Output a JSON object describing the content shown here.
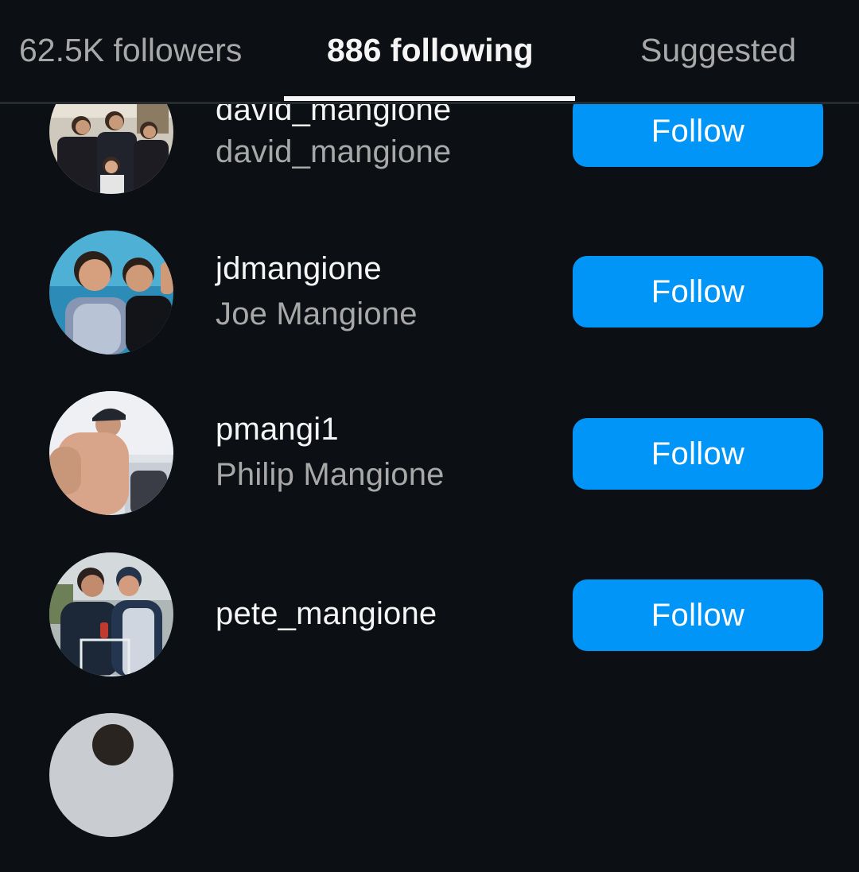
{
  "tabs": [
    {
      "label": "62.5K followers",
      "active": false
    },
    {
      "label": "886 following",
      "active": true
    },
    {
      "label": "Suggested",
      "active": false
    }
  ],
  "users": [
    {
      "username": "david_mangione",
      "full_name": "david_mangione",
      "button": "Follow"
    },
    {
      "username": "jdmangione",
      "full_name": "Joe Mangione",
      "button": "Follow"
    },
    {
      "username": "pmangi1",
      "full_name": "Philip Mangione",
      "button": "Follow"
    },
    {
      "username": "pete_mangione",
      "full_name": "",
      "button": "Follow"
    }
  ],
  "colors": {
    "background": "#0c1014",
    "button": "#0095f6",
    "secondary_text": "#a8a8a8"
  }
}
